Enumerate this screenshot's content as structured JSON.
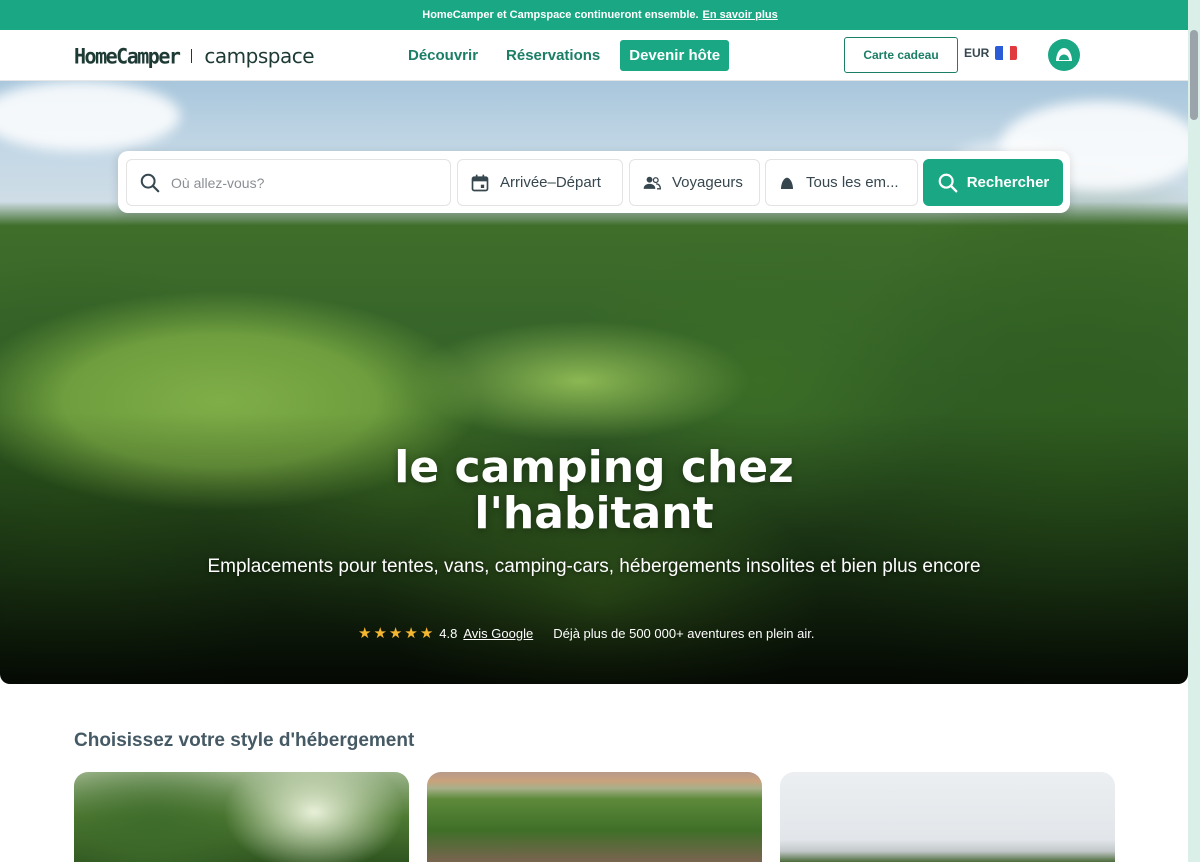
{
  "announcement": {
    "text": "HomeCamper et Campspace continueront ensemble.",
    "link": "En savoir plus"
  },
  "header": {
    "logo_primary": "HomeCamper",
    "logo_secondary": "campspace",
    "nav": [
      "Découvrir",
      "Réservations"
    ],
    "cta": "Devenir hôte",
    "gift_card": "Carte cadeau",
    "currency": "EUR"
  },
  "search": {
    "placeholder": "Où allez-vous?",
    "dates": "Arrivée–Départ",
    "guests": "Voyageurs",
    "type": "Tous les em...",
    "button": "Rechercher"
  },
  "hero": {
    "title_line1": "le camping chez",
    "title_line2": "l'habitant",
    "subtitle": "Emplacements pour tentes, vans, camping-cars, hébergements insolites et bien plus encore",
    "rating_value": "4.8",
    "rating_link": "Avis Google",
    "adventures": "Déjà plus de 500 000+ aventures en plein air.",
    "star_count": 5
  },
  "section": {
    "title": "Choisissez votre style d'hébergement"
  },
  "colors": {
    "brand": "#1aa784",
    "brand_dark": "#1b7e66",
    "star": "#f5b731"
  },
  "icons": [
    "search-icon",
    "calendar-icon",
    "people-icon",
    "tent-icon",
    "search-icon",
    "star-icon",
    "flag-fr-icon",
    "user-avatar-icon"
  ]
}
